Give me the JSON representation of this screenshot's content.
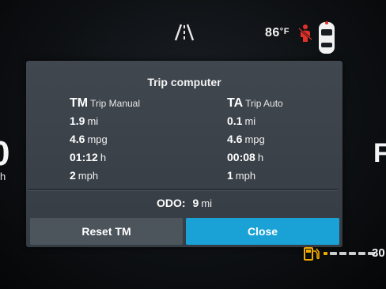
{
  "status_bar": {
    "temperature": "86",
    "temperature_unit": "°F"
  },
  "edge_fragments": {
    "left_digit": "0",
    "left_letter": "h",
    "right_letter": "F",
    "bottom_right_number": "30"
  },
  "dialog": {
    "title": "Trip computer",
    "trip_manual": {
      "abbr": "TM",
      "name": "Trip Manual",
      "rows": [
        {
          "value": "1.9",
          "unit": "mi"
        },
        {
          "value": "4.6",
          "unit": "mpg"
        },
        {
          "value": "01:12",
          "unit": "h"
        },
        {
          "value": "2",
          "unit": "mph"
        }
      ]
    },
    "trip_auto": {
      "abbr": "TA",
      "name": "Trip Auto",
      "rows": [
        {
          "value": "0.1",
          "unit": "mi"
        },
        {
          "value": "4.6",
          "unit": "mpg"
        },
        {
          "value": "00:08",
          "unit": "h"
        },
        {
          "value": "1",
          "unit": "mph"
        }
      ]
    },
    "odometer": {
      "label": "ODO:",
      "value": "9",
      "unit": "mi"
    },
    "buttons": {
      "reset_label": "Reset TM",
      "close_label": "Close"
    }
  },
  "colors": {
    "close_button": "#1aa2d6",
    "seatbelt_warning": "#e0302a",
    "fuel_warning": "#f2a900"
  },
  "icons": [
    "lane-assist-icon",
    "seatbelt-warning-icon",
    "car-top-view-icon",
    "fuel-pump-icon"
  ]
}
